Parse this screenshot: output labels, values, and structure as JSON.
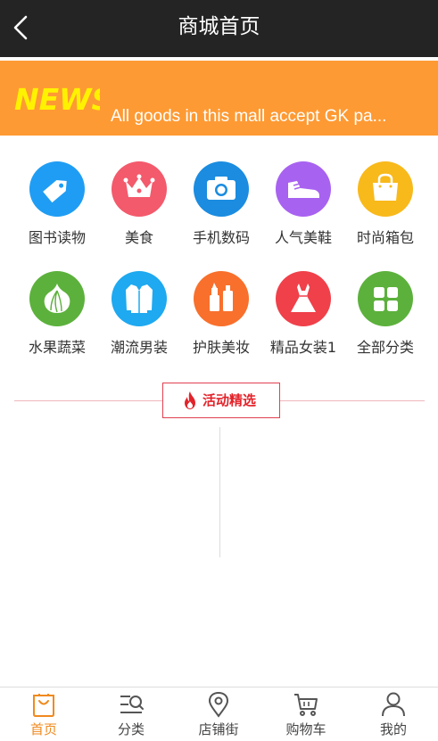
{
  "header": {
    "title": "商城首页"
  },
  "news": {
    "logo_text": "NEWS",
    "headline": "All goods in this mall accept GK pa..."
  },
  "categories": [
    {
      "label": "图书读物",
      "icon": "tag-icon",
      "color": "#1f9df4"
    },
    {
      "label": "美食",
      "icon": "crown-icon",
      "color": "#f35a6c"
    },
    {
      "label": "手机数码",
      "icon": "camera-icon",
      "color": "#1b8ce0"
    },
    {
      "label": "人气美鞋",
      "icon": "shoe-icon",
      "color": "#a862f0"
    },
    {
      "label": "时尚箱包",
      "icon": "bag-icon",
      "color": "#f8b91b"
    },
    {
      "label": "水果蔬菜",
      "icon": "garlic-icon",
      "color": "#5cb13c"
    },
    {
      "label": "潮流男装",
      "icon": "jacket-icon",
      "color": "#1ea9f0"
    },
    {
      "label": "护肤美妆",
      "icon": "cosmetics-icon",
      "color": "#f8702c"
    },
    {
      "label": "精品女装1",
      "icon": "dress-icon",
      "color": "#f0404a"
    },
    {
      "label": "全部分类",
      "icon": "grid-icon",
      "color": "#5cb13c"
    }
  ],
  "section": {
    "title": "活动精选",
    "accent": "#e2232a"
  },
  "tabbar": {
    "items": [
      {
        "label": "首页",
        "icon": "shopping-bag-icon",
        "active": true
      },
      {
        "label": "分类",
        "icon": "category-search-icon",
        "active": false
      },
      {
        "label": "店铺街",
        "icon": "location-pin-icon",
        "active": false
      },
      {
        "label": "购物车",
        "icon": "cart-icon",
        "active": false
      },
      {
        "label": "我的",
        "icon": "user-icon",
        "active": false
      }
    ],
    "active_color": "#f08a1e"
  }
}
